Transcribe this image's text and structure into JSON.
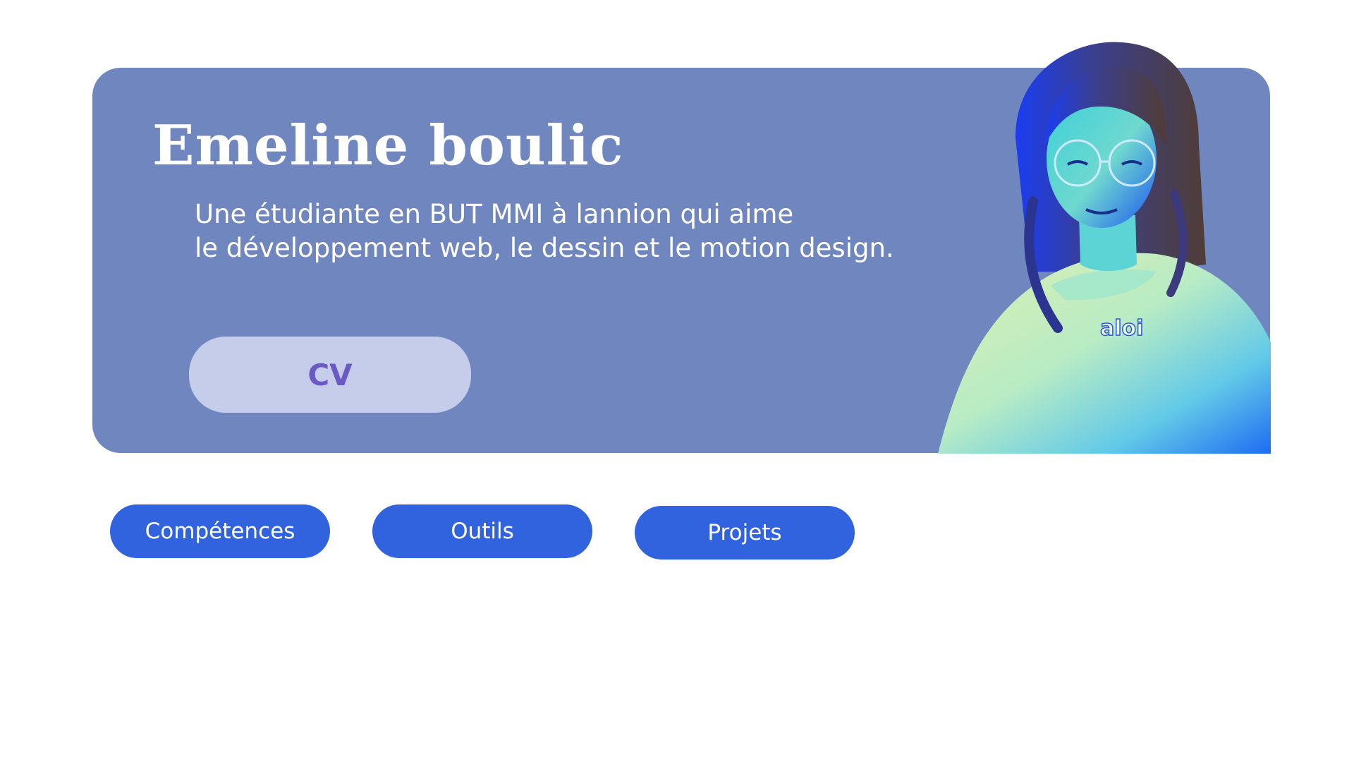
{
  "hero": {
    "title": "Emeline boulic",
    "description_line1": "Une étudiante en BUT MMI à lannion qui aime",
    "description_line2": "le développement web, le dessin et le motion design.",
    "cv_label": "CV",
    "portrait_icon": "portrait-photo",
    "colors": {
      "card": "#6f86bf",
      "cv_button_bg": "#c6cdeb",
      "cv_button_text": "#6a5ac4"
    }
  },
  "nav": {
    "items": [
      {
        "label": "Compétences"
      },
      {
        "label": "Outils"
      },
      {
        "label": "Projets"
      }
    ],
    "color": "#3163df"
  }
}
